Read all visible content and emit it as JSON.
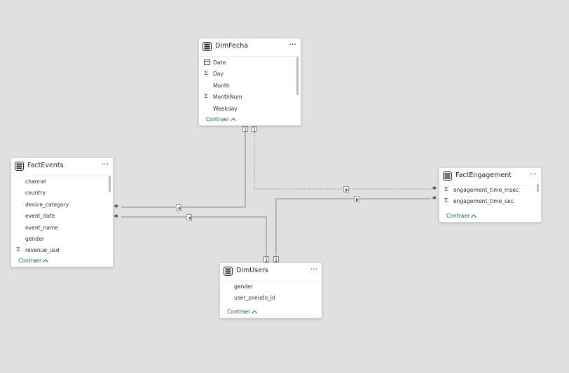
{
  "colors": {
    "background": "#e1e0df",
    "card": "#ffffff",
    "relationship_line": "#a6a6a6",
    "collapse_text": "#1f5f5b"
  },
  "tables": {
    "dimfecha": {
      "title": "DimFecha",
      "more": "···",
      "collapse": "Contraer",
      "fields": [
        {
          "icon": "calendar-icon",
          "name": "Date"
        },
        {
          "icon": "sigma-icon",
          "name": "Day"
        },
        {
          "icon": "none",
          "name": "Month"
        },
        {
          "icon": "sigma-icon",
          "name": "MonthNum"
        },
        {
          "icon": "none",
          "name": "Weekday"
        }
      ]
    },
    "factevents": {
      "title": "FactEvents",
      "more": "···",
      "collapse": "Contraer",
      "fields": [
        {
          "icon": "none",
          "name": "channel"
        },
        {
          "icon": "none",
          "name": "country"
        },
        {
          "icon": "none",
          "name": "device_category"
        },
        {
          "icon": "none",
          "name": "event_date"
        },
        {
          "icon": "none",
          "name": "event_name"
        },
        {
          "icon": "none",
          "name": "gender"
        },
        {
          "icon": "sigma-icon",
          "name": "revenue_usd"
        }
      ]
    },
    "factengagement": {
      "title": "FactEngagement",
      "more": "···",
      "collapse": "Contraer",
      "fields": [
        {
          "icon": "sigma-icon",
          "name": "engagement_time_msec"
        },
        {
          "icon": "sigma-icon",
          "name": "engagement_time_sec"
        }
      ]
    },
    "dimusers": {
      "title": "DimUsers",
      "more": "···",
      "collapse": "Contraer",
      "fields": [
        {
          "icon": "none",
          "name": "gender"
        },
        {
          "icon": "none",
          "name": "user_pseudo_id"
        }
      ]
    }
  },
  "relationships": {
    "one_label": "1",
    "many_label": "*"
  }
}
